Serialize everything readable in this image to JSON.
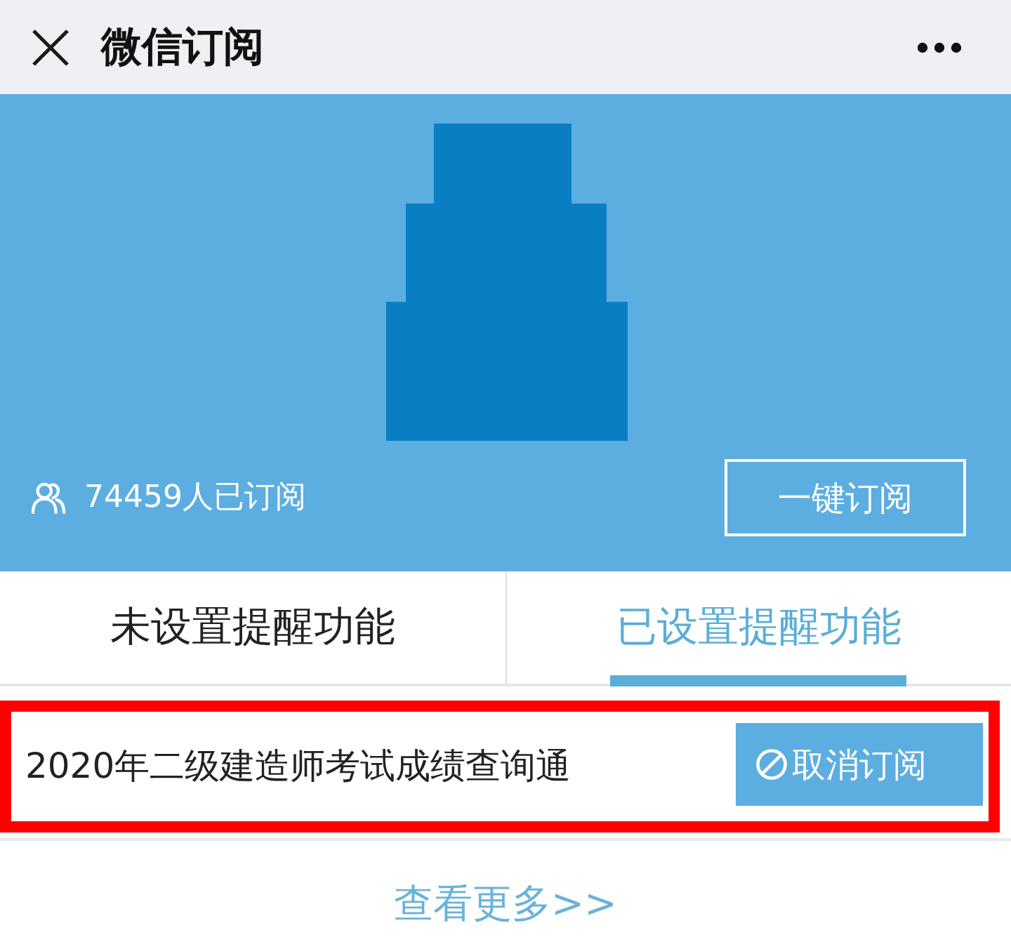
{
  "header": {
    "title": "微信订阅"
  },
  "banner": {
    "subscribers": "74459人已订阅",
    "subscribe_button": "一键订阅"
  },
  "tabs": [
    {
      "label": "未设置提醒功能",
      "selected": false
    },
    {
      "label": "已设置提醒功能",
      "selected": true
    }
  ],
  "subscriptions": [
    {
      "title": "2020年二级建造师考试成绩查询通",
      "button": "取消订阅",
      "highlighted": true
    }
  ],
  "more_link": "查看更多>>"
}
